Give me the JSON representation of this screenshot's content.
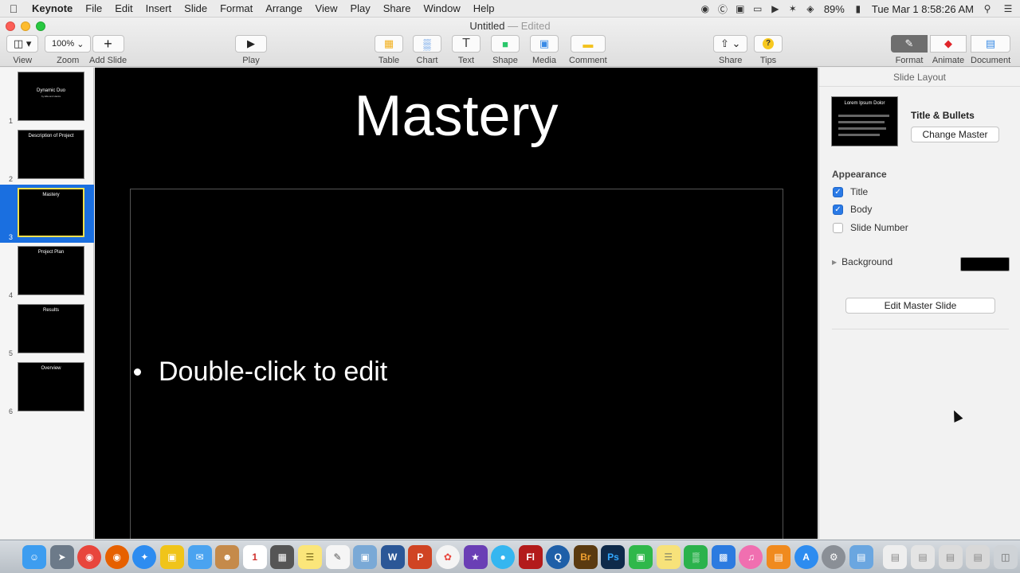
{
  "menubar": {
    "app": "Keynote",
    "items": [
      "File",
      "Edit",
      "Insert",
      "Slide",
      "Format",
      "Arrange",
      "View",
      "Play",
      "Share",
      "Window",
      "Help"
    ],
    "battery": "89%",
    "datetime": "Tue Mar 1  8:58:26 AM"
  },
  "window": {
    "title": "Untitled",
    "separator": "—",
    "edited": "Edited"
  },
  "toolbar": {
    "view": {
      "label": "View"
    },
    "zoom": {
      "label": "Zoom",
      "value": "100%"
    },
    "add_slide": {
      "label": "Add Slide"
    },
    "play": {
      "label": "Play"
    },
    "table": {
      "label": "Table"
    },
    "chart": {
      "label": "Chart"
    },
    "text": {
      "label": "Text"
    },
    "shape": {
      "label": "Shape"
    },
    "media": {
      "label": "Media"
    },
    "comment": {
      "label": "Comment"
    },
    "share": {
      "label": "Share"
    },
    "tips": {
      "label": "Tips"
    },
    "format": {
      "label": "Format"
    },
    "animate": {
      "label": "Animate"
    },
    "document": {
      "label": "Document"
    }
  },
  "slides": [
    {
      "number": "1",
      "title": "Dynamic Duo",
      "subtitle": "by Ella and Hanks"
    },
    {
      "number": "2",
      "title": "Description of Project"
    },
    {
      "number": "3",
      "title": "Mastery"
    },
    {
      "number": "4",
      "title": "Project Plan"
    },
    {
      "number": "5",
      "title": "Results"
    },
    {
      "number": "6",
      "title": "Overview"
    }
  ],
  "selected_slide": "3",
  "canvas": {
    "title": "Mastery",
    "bullet": "Double-click to edit"
  },
  "inspector": {
    "header": "Slide Layout",
    "thumb_title": "Lorem Ipsum Dolor",
    "layout_name": "Title & Bullets",
    "change_master": "Change Master",
    "appearance": "Appearance",
    "options": [
      {
        "label": "Title",
        "checked": true
      },
      {
        "label": "Body",
        "checked": true
      },
      {
        "label": "Slide Number",
        "checked": false
      }
    ],
    "background": {
      "label": "Background",
      "color": "#000000"
    },
    "edit_master": "Edit Master Slide"
  },
  "colors": {
    "accent": "#1a6fe0",
    "selected_border": "#f4e04d",
    "animate_icon": "#e0252a"
  },
  "dock": [
    "finder-icon",
    "launchpad-icon",
    "chrome-icon",
    "firefox-icon",
    "safari-icon",
    "preview-icon",
    "mail-icon",
    "contacts-icon",
    "calendar-icon",
    "calculator-icon",
    "notes-icon",
    "textedit-icon",
    "preview-icon",
    "word-icon",
    "powerpoint-icon",
    "photos-icon",
    "imovie-icon",
    "messages-icon",
    "flash-icon",
    "quicktime-icon",
    "bridge-icon",
    "photoshop-icon",
    "facetime-icon",
    "stickies-icon",
    "numbers-icon",
    "keynote-icon",
    "itunes-icon",
    "ibooks-icon",
    "appstore-icon",
    "system-preferences-icon",
    "folder-icon",
    "document-icon",
    "document-icon",
    "folder-icon",
    "folder-icon",
    "trash-icon"
  ]
}
